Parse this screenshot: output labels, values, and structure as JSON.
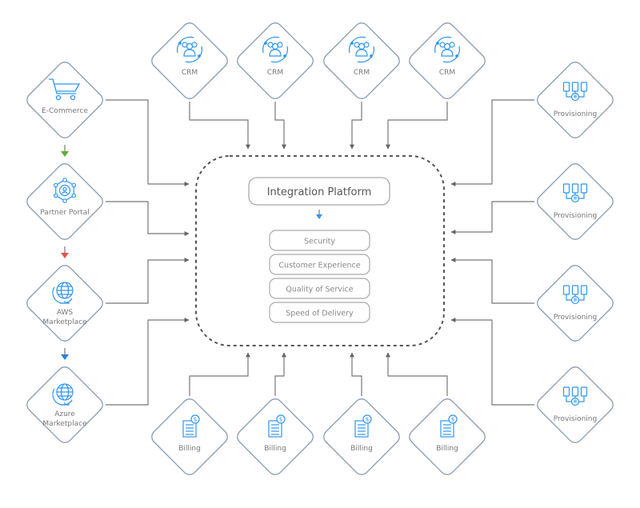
{
  "colors": {
    "icon": "#2f96f0",
    "border": "#8a9bb0",
    "line": "#777777",
    "green": "#58b030",
    "red": "#e85050",
    "blue": "#2f7fd8",
    "text": "#777777"
  },
  "platform": {
    "title": "Integration Platform",
    "items": [
      "Security",
      "Customer Experience",
      "Quality of Service",
      "Speed of Delivery"
    ]
  },
  "top_nodes": [
    {
      "label": "CRM",
      "icon": "users-group-icon"
    },
    {
      "label": "CRM",
      "icon": "users-group-icon"
    },
    {
      "label": "CRM",
      "icon": "users-group-icon"
    },
    {
      "label": "CRM",
      "icon": "users-group-icon"
    }
  ],
  "bottom_nodes": [
    {
      "label": "Billing",
      "icon": "invoice-dollar-icon"
    },
    {
      "label": "Billing",
      "icon": "invoice-dollar-icon"
    },
    {
      "label": "Billing",
      "icon": "invoice-dollar-icon"
    },
    {
      "label": "Billing",
      "icon": "invoice-dollar-icon"
    }
  ],
  "left_nodes": [
    {
      "label": [
        "E-Commerce"
      ],
      "icon": "shopping-cart-icon"
    },
    {
      "label": [
        "Partner Portal"
      ],
      "icon": "partner-network-icon"
    },
    {
      "label": [
        "AWS",
        "Marketplace"
      ],
      "icon": "globe-icon"
    },
    {
      "label": [
        "Azure",
        "Marketplace"
      ],
      "icon": "globe-icon"
    }
  ],
  "right_nodes": [
    {
      "label": "Provisioning",
      "icon": "provisioning-devices-icon"
    },
    {
      "label": "Provisioning",
      "icon": "provisioning-devices-icon"
    },
    {
      "label": "Provisioning",
      "icon": "provisioning-devices-icon"
    },
    {
      "label": "Provisioning",
      "icon": "provisioning-devices-icon"
    }
  ]
}
